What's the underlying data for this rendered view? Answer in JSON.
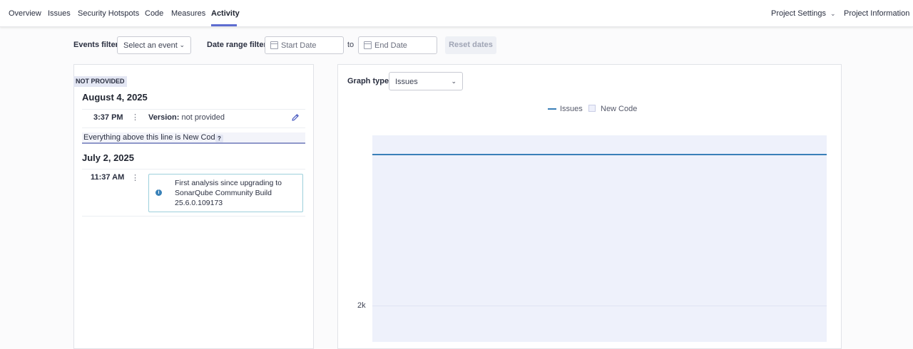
{
  "nav": {
    "tabs": [
      "Overview",
      "Issues",
      "Security Hotspots",
      "Code",
      "Measures",
      "Activity"
    ],
    "active_tab": "Activity",
    "project_settings": "Project Settings",
    "project_information": "Project Information"
  },
  "filters": {
    "events_label": "Events filter",
    "events_select": "Select an event",
    "date_range_label": "Date range filter",
    "start_placeholder": "Start Date",
    "to": "to",
    "end_placeholder": "End Date",
    "reset": "Reset dates"
  },
  "history": {
    "badge": "NOT PROVIDED",
    "groups": [
      {
        "date": "August 4, 2025",
        "entries": [
          {
            "time": "3:37 PM",
            "version_label": "Version:",
            "version_value": "not provided"
          }
        ]
      },
      {
        "date": "July 2, 2025",
        "entries": [
          {
            "time": "11:37 AM",
            "message_lines": [
              "First analysis since upgrading to",
              "SonarQube Community Build",
              "25.6.0.109173"
            ]
          }
        ]
      }
    ],
    "new_code_label": "Everything above this line is New Code",
    "help": "?"
  },
  "graph": {
    "type_label": "Graph type",
    "type_value": "Issues",
    "legend": [
      "Issues",
      "New Code"
    ],
    "y_tick": "2k",
    "colors": {
      "series": "#3a7fb8",
      "new_code_area": "#eef1fb"
    }
  },
  "chart_data": {
    "type": "line",
    "series": [
      {
        "name": "Issues",
        "values": []
      }
    ],
    "y_ticks": [
      "2k"
    ]
  }
}
